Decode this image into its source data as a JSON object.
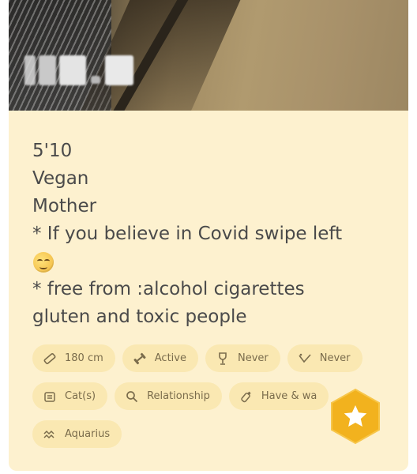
{
  "bio": {
    "lines": [
      "5'10",
      "Vegan",
      "Mother",
      "* If you believe in Covid swipe left",
      "* free from :alcohol cigarettes",
      "gluten and toxic people"
    ]
  },
  "chips": [
    {
      "icon": "ruler-icon",
      "label": "180 cm"
    },
    {
      "icon": "dumbbell-icon",
      "label": "Active"
    },
    {
      "icon": "wine-glass-icon",
      "label": "Never"
    },
    {
      "icon": "smoking-icon",
      "label": "Never"
    },
    {
      "icon": "pet-icon",
      "label": "Cat(s)"
    },
    {
      "icon": "search-icon",
      "label": "Relationship"
    },
    {
      "icon": "baby-bottle-icon",
      "label": "Have & wa"
    },
    {
      "icon": "zodiac-icon",
      "label": "Aquarius"
    }
  ],
  "colors": {
    "card_bg": "#fdf1cf",
    "chip_bg": "#fae8b2",
    "accent": "#f2b21e"
  },
  "fab": {
    "icon": "star-icon"
  }
}
